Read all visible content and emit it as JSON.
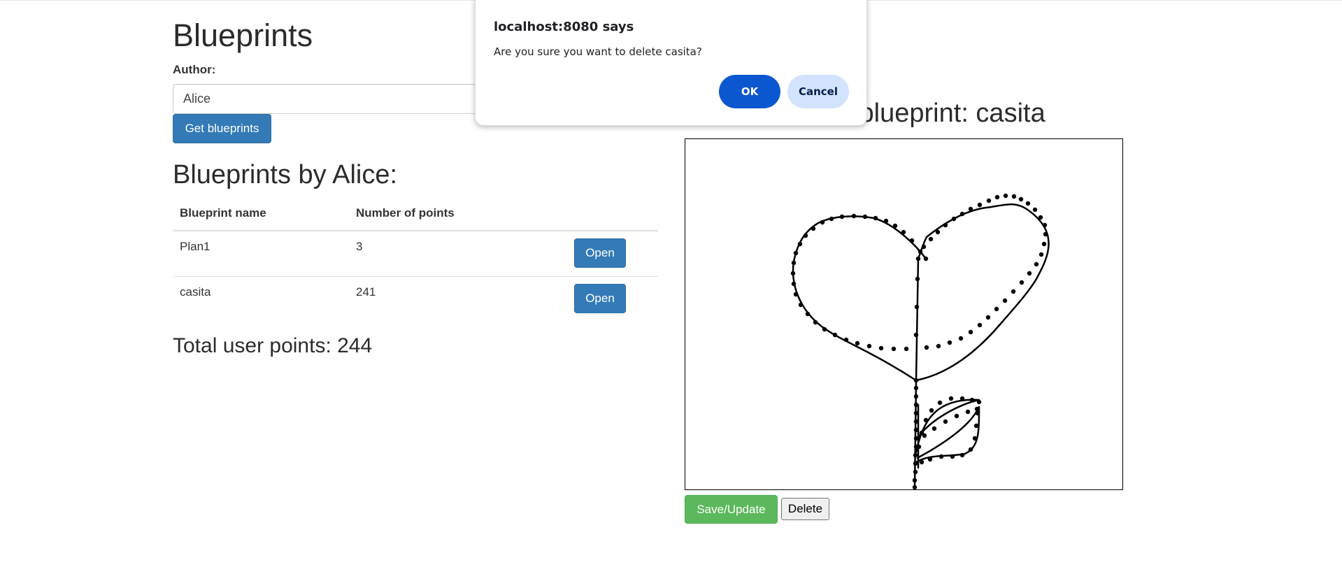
{
  "page": {
    "title": "Blueprints"
  },
  "author": {
    "label": "Author:",
    "value": "Alice"
  },
  "buttons": {
    "get_blueprints": "Get blueprints",
    "save_update": "Save/Update",
    "delete": "Delete",
    "open": "Open"
  },
  "list": {
    "heading": "Blueprints by Alice:",
    "columns": [
      "Blueprint name",
      "Number of points"
    ],
    "rows": [
      {
        "name": "Plan1",
        "points": "3"
      },
      {
        "name": "casita",
        "points": "241"
      }
    ],
    "total": "Total user points: 244"
  },
  "current": {
    "title": "Current blueprint: casita"
  },
  "dialog": {
    "title": "localhost:8080 says",
    "message": "Are you sure you want to delete casita?",
    "ok": "OK",
    "cancel": "Cancel"
  }
}
